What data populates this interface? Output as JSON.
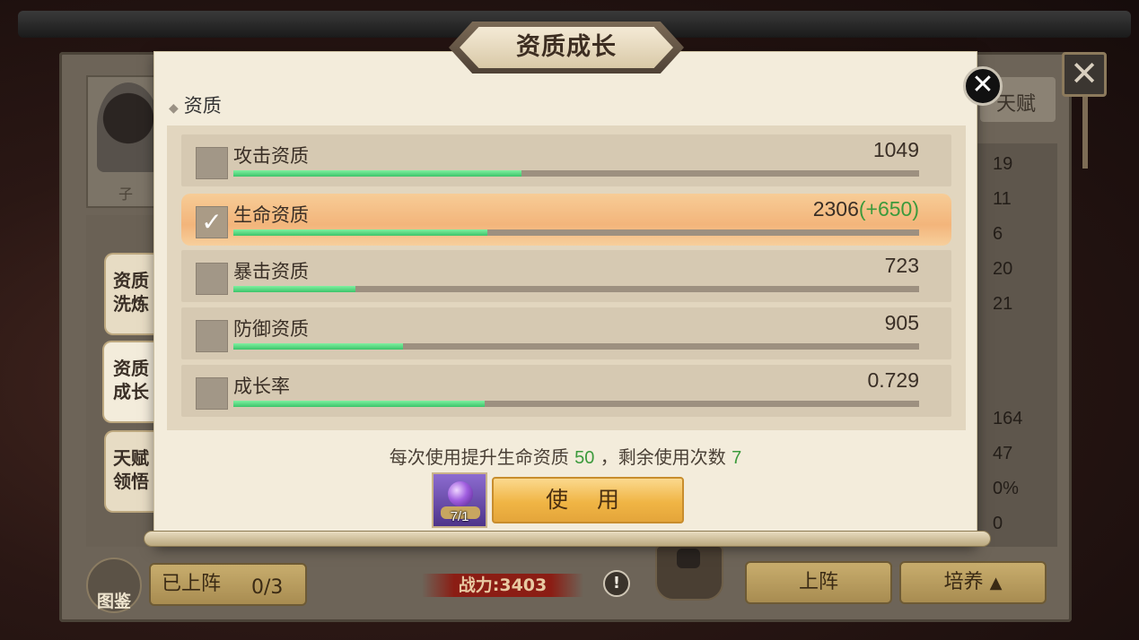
{
  "dialog": {
    "title": "资质成长",
    "section_label": "资质",
    "close_icon": "✕"
  },
  "attributes": [
    {
      "label": "攻击资质",
      "value": "1049",
      "bonus": "",
      "progress": 0.42,
      "selected": false
    },
    {
      "label": "生命资质",
      "value": "2306",
      "bonus": "(+650)",
      "progress": 0.37,
      "selected": true
    },
    {
      "label": "暴击资质",
      "value": "723",
      "bonus": "",
      "progress": 0.178,
      "selected": false
    },
    {
      "label": "防御资质",
      "value": "905",
      "bonus": "",
      "progress": 0.248,
      "selected": false
    },
    {
      "label": "成长率",
      "value": "0.729",
      "bonus": "",
      "progress": 0.366,
      "selected": false
    }
  ],
  "hint": {
    "prefix": "每次使用提升生命资质",
    "amount": "50",
    "middle": "，剩余使用次数",
    "remaining": "7"
  },
  "item": {
    "count": "7/1",
    "icon": "purple-orb-icon"
  },
  "use_button": "使 用",
  "side_tabs": [
    {
      "line1": "资质",
      "line2": "洗炼",
      "active": false
    },
    {
      "line1": "资质",
      "line2": "成长",
      "active": true
    },
    {
      "line1": "天赋",
      "line2": "领悟",
      "active": false
    }
  ],
  "background": {
    "talent_tab": "天赋",
    "hero_name_fragment": "子",
    "stats": [
      "19",
      "11",
      "6",
      "20",
      "21",
      "164",
      "47",
      "0%",
      "0"
    ],
    "atlas_label": "图鉴",
    "deployed_label": "已上阵",
    "deployed_count": "0/3",
    "power": "战力:3403",
    "deploy_button": "上阵",
    "train_button": "培养"
  },
  "colors": {
    "bonus_green": "#3c9a3c",
    "progress_green": "#3cc46a",
    "use_button_gold": "#f0b545",
    "selected_row": "#f3b57b"
  }
}
